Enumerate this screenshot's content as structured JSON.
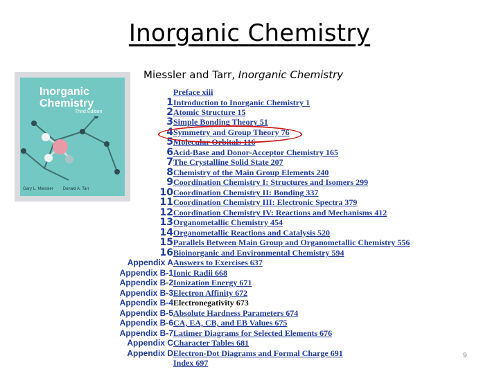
{
  "slide": {
    "title": "Inorganic Chemistry",
    "subtitle_authors": "Miessler and Tarr, ",
    "subtitle_book": "Inorganic Chemistry",
    "page_number": "9"
  },
  "cover": {
    "title_line1": "Inorganic",
    "title_line2": "Chemistry",
    "edition": "Third Edition",
    "author1": "Gary L. Miessler",
    "author2": "Donald A. Tarr",
    "bg_color": "#74c8c3"
  },
  "toc": [
    {
      "num": "",
      "text": "Preface    xiii"
    },
    {
      "num": "1",
      "text": "Introduction to Inorganic Chemistry    1"
    },
    {
      "num": "2",
      "text": "Atomic Structure    15"
    },
    {
      "num": "3",
      "text": "Simple Bonding Theory    51"
    },
    {
      "num": "4",
      "text": "Symmetry and Group Theory    76"
    },
    {
      "num": "5",
      "text": "Molecular Orbitals    116"
    },
    {
      "num": "6",
      "text": "Acid-Base and Donor-Acceptor Chemistry    165"
    },
    {
      "num": "7",
      "text": "The Crystalline Solid State    207"
    },
    {
      "num": "8",
      "text": "Chemistry of the Main Group Elements    240"
    },
    {
      "num": "9",
      "text": "Coordination Chemistry I: Structures and Isomers    299"
    },
    {
      "num": "10",
      "text": "Coordination Chemistry II: Bonding    337"
    },
    {
      "num": "11",
      "text": "Coordination Chemistry III: Electronic Spectra    379"
    },
    {
      "num": "12",
      "text": "Coordination Chemistry IV: Reactions and Mechanisms    412"
    },
    {
      "num": "13",
      "text": "Organometallic Chemistry    454"
    },
    {
      "num": "14",
      "text": "Organometallic Reactions and Catalysis    520"
    },
    {
      "num": "15",
      "text": "Parallels Between Main Group and Organometallic Chemistry    556"
    },
    {
      "num": "16",
      "text": "Bioinorganic and Environmental Chemistry    594"
    },
    {
      "num": "Appendix A",
      "text": "Answers to Exercises    637"
    },
    {
      "num": "Appendix B-1",
      "text": "Ionic Radii    668"
    },
    {
      "num": "Appendix B-2",
      "text": "Ionization Energy    671"
    },
    {
      "num": "Appendix B-3",
      "text": "Electron Affinity    672"
    },
    {
      "num": "Appendix B-4",
      "text": "Electronegativity    673"
    },
    {
      "num": "Appendix B-5",
      "text": "Absolute Hardness Parameters    674"
    },
    {
      "num": "Appendix B-6",
      "text": "CA, EA, CB, and EB Values    675"
    },
    {
      "num": "Appendix B-7",
      "text": "Latimer Diagrams for Selected Elements    676"
    },
    {
      "num": "Appendix C",
      "text": "Character Tables    681"
    },
    {
      "num": "Appendix D",
      "text": "Electron-Dot Diagrams and Formal Charge    691"
    },
    {
      "num": "",
      "text": "Index    697"
    }
  ],
  "highlight_color": "#d11717",
  "link_color": "#1f3b9c"
}
